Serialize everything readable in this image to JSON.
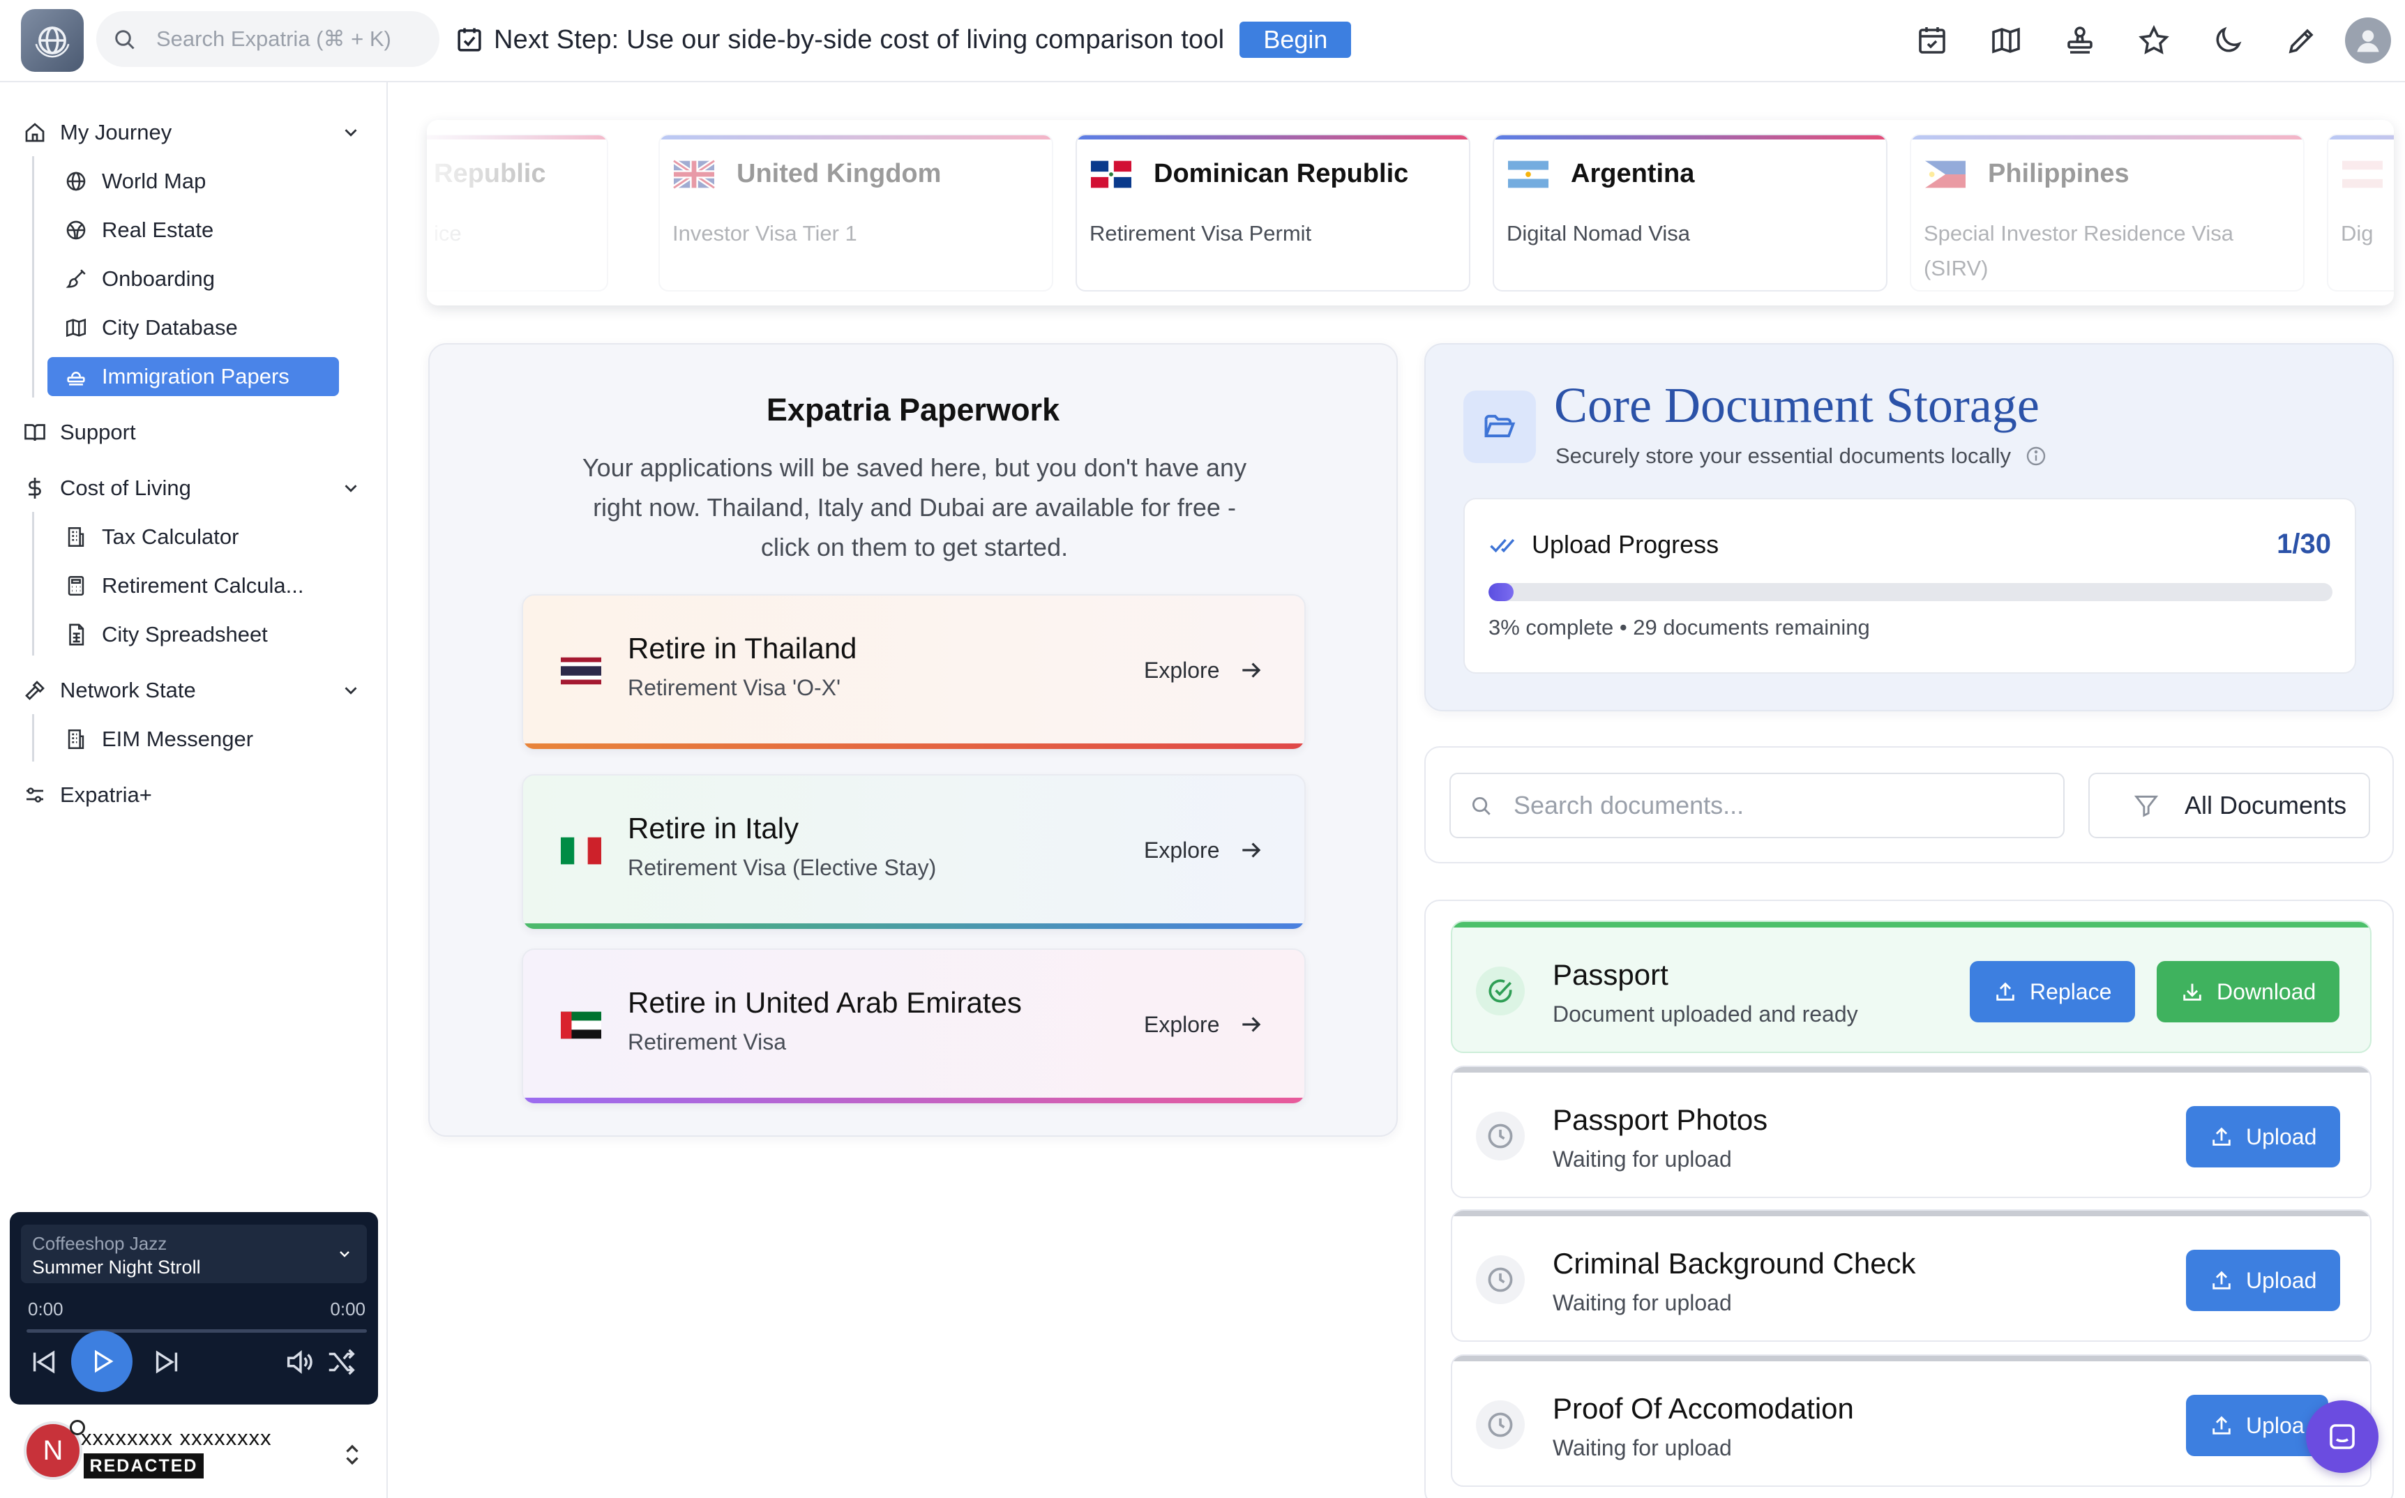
{
  "topbar": {
    "search_placeholder": "Search Expatria (⌘ + K)",
    "next_step": "Next Step: Use our side-by-side cost of living comparison tool",
    "begin_label": "Begin",
    "icons": [
      "calendar-check-icon",
      "map-icon",
      "stamp-icon",
      "star-icon",
      "moon-icon",
      "pencil-icon",
      "user-avatar-icon"
    ]
  },
  "sidebar": {
    "my_journey": "My Journey",
    "journey_items": [
      "World Map",
      "Real Estate",
      "Onboarding",
      "City Database",
      "Immigration Papers"
    ],
    "support": "Support",
    "cost_of_living": "Cost of Living",
    "col_items": [
      "Tax Calculator",
      "Retirement Calcula...",
      "City Spreadsheet"
    ],
    "network_state": "Network State",
    "network_items": [
      "EIM Messenger"
    ],
    "expatria_plus": "Expatria+",
    "active_item": "Immigration Papers"
  },
  "player": {
    "genre": "Coffeeshop Jazz",
    "track": "Summer Night Stroll",
    "time_current": "0:00",
    "time_total": "0:00"
  },
  "user": {
    "initial": "N",
    "name": "xxxxxxxx xxxxxxxx",
    "tag": "REDACTED"
  },
  "visa_cards": [
    {
      "country": "Republic",
      "visa": "ice",
      "faded": true
    },
    {
      "country": "United Kingdom",
      "visa": "Investor Visa Tier 1",
      "faded": true
    },
    {
      "country": "Dominican Republic",
      "visa": "Retirement Visa Permit",
      "faded": false
    },
    {
      "country": "Argentina",
      "visa": "Digital Nomad Visa",
      "faded": false
    },
    {
      "country": "Philippines",
      "visa": "Special Investor Residence Visa (SIRV)",
      "faded": true
    },
    {
      "country": "",
      "visa": "Dig",
      "faded": true
    }
  ],
  "paperwork": {
    "title": "Expatria Paperwork",
    "description": "Your applications will be saved here, but you don't have any right now. Thailand, Italy and Dubai are available for free - click on them to get started.",
    "explore_label": "Explore",
    "cards": [
      {
        "title": "Retire in Thailand",
        "visa": "Retirement Visa 'O-X'"
      },
      {
        "title": "Retire in Italy",
        "visa": "Retirement Visa (Elective Stay)"
      },
      {
        "title": "Retire in United Arab Emirates",
        "visa": "Retirement Visa"
      }
    ]
  },
  "storage": {
    "title": "Core Document Storage",
    "subtitle": "Securely store your essential documents locally",
    "progress_label": "Upload Progress",
    "progress_count": "1/30",
    "progress_fraction": 0.03,
    "progress_status": "3% complete • 29 documents remaining"
  },
  "doc_search": {
    "placeholder": "Search documents...",
    "filter_label": "All Documents"
  },
  "documents": [
    {
      "title": "Passport",
      "status": "Document uploaded and ready",
      "actions": [
        "Replace",
        "Download"
      ]
    },
    {
      "title": "Passport Photos",
      "status": "Waiting for upload",
      "actions": [
        "Upload"
      ]
    },
    {
      "title": "Criminal Background Check",
      "status": "Waiting for upload",
      "actions": [
        "Upload"
      ]
    },
    {
      "title": "Proof Of Accomodation",
      "status": "Waiting for upload",
      "actions": [
        "Uploa"
      ]
    }
  ],
  "colors": {
    "primary_blue": "#3d7fe0",
    "success_green": "#3fb25e",
    "storage_title": "#2b52a8",
    "player_bg": "#0f1a2e"
  }
}
